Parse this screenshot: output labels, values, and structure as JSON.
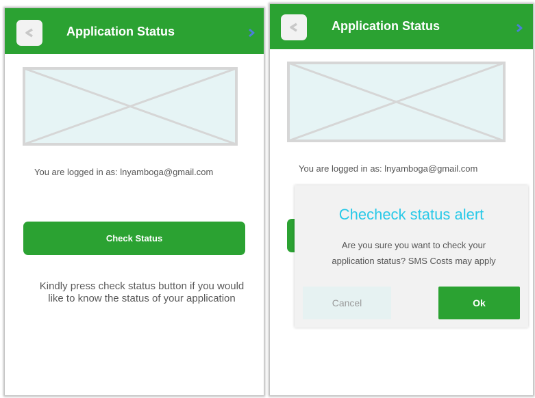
{
  "colors": {
    "header_green": "#2ba232",
    "button_green": "#2ba232",
    "modal_title_cyan": "#29c9e8",
    "placeholder_fill": "#e6f4f5",
    "placeholder_stroke": "#d6d6d6",
    "forward_chevron": "#4a7fd6",
    "back_chevron": "#c8c8c8"
  },
  "icons": {
    "back": "chevron-left-icon",
    "forward": "chevron-right-icon",
    "image_placeholder": "image-placeholder"
  },
  "screen_left": {
    "header_title": "Application Status",
    "logged_in": "You are logged in as: lnyamboga@gmail.com",
    "check_button": "Check Status",
    "hint": "Kindly press check status button if you would like to know the status of your application"
  },
  "screen_right": {
    "header_title": "Application Status",
    "logged_in": "You are logged in as: lnyamboga@gmail.com",
    "modal": {
      "title": "Checheck status alert",
      "message": "Are you sure you want to check your application status? SMS Costs may apply",
      "cancel_label": "Cancel",
      "ok_label": "Ok"
    }
  }
}
